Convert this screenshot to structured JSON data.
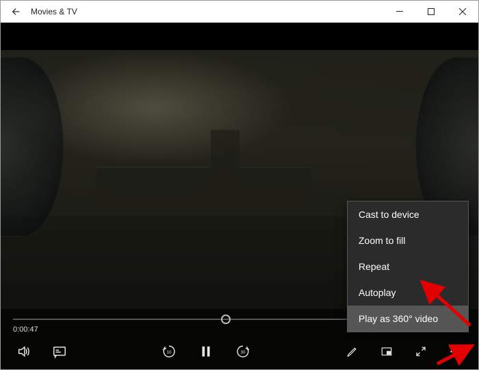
{
  "window": {
    "title": "Movies & TV"
  },
  "playback": {
    "current_time": "0:00:47",
    "progress_fraction": 0.47
  },
  "menu": {
    "items": [
      "Cast to device",
      "Zoom to fill",
      "Repeat",
      "Autoplay",
      "Play as 360° video"
    ],
    "highlighted_index": 4
  }
}
